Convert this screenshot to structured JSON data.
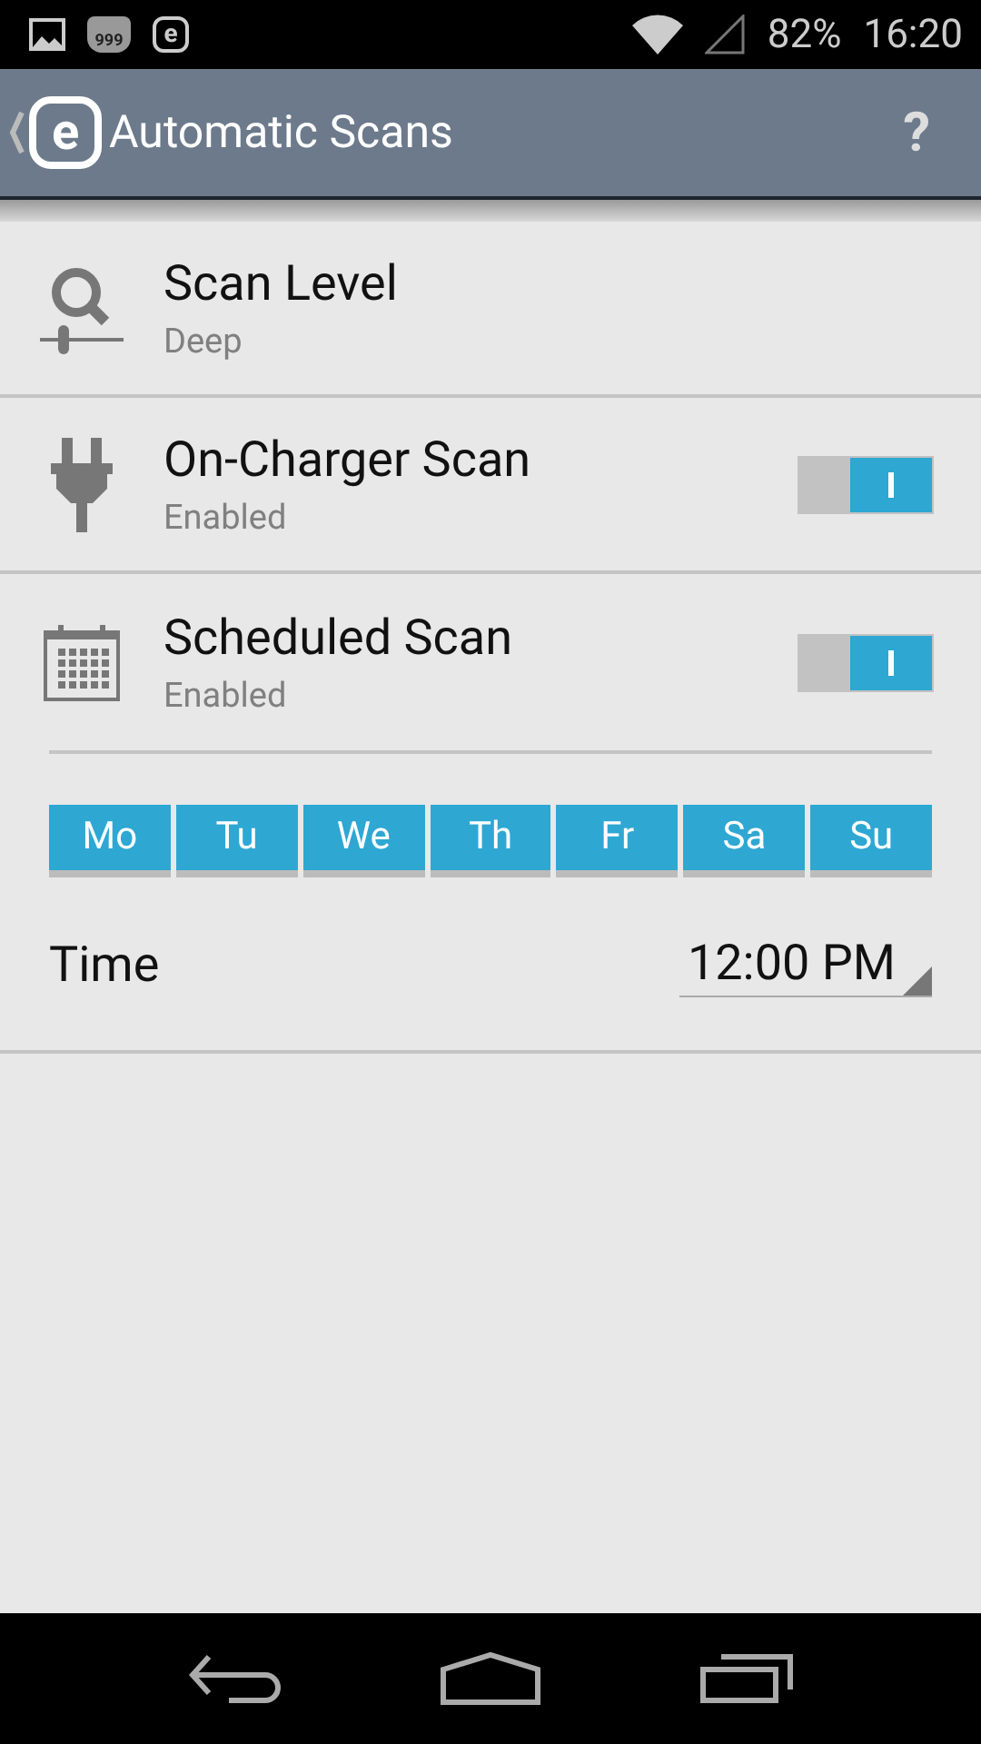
{
  "status_bar": {
    "notification_badge": "999",
    "app_letter": "e",
    "battery": "82%",
    "time": "16:20"
  },
  "app_bar": {
    "logo_letter": "e",
    "title": "Automatic Scans",
    "help": "?"
  },
  "settings": [
    {
      "kind": "level",
      "title": "Scan Level",
      "subtitle": "Deep"
    },
    {
      "kind": "charger",
      "title": "On-Charger Scan",
      "subtitle": "Enabled",
      "on": true
    },
    {
      "kind": "schedule",
      "title": "Scheduled Scan",
      "subtitle": "Enabled",
      "on": true
    }
  ],
  "days": [
    {
      "label": "Mo",
      "selected": true
    },
    {
      "label": "Tu",
      "selected": true
    },
    {
      "label": "We",
      "selected": true
    },
    {
      "label": "Th",
      "selected": true
    },
    {
      "label": "Fr",
      "selected": true
    },
    {
      "label": "Sa",
      "selected": true
    },
    {
      "label": "Su",
      "selected": true
    }
  ],
  "time": {
    "label": "Time",
    "value": "12:00 PM"
  }
}
